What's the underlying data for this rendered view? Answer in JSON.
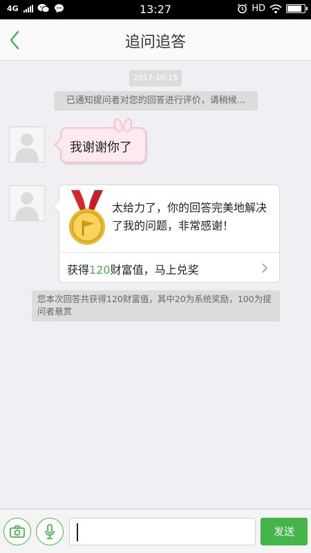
{
  "status_bar": {
    "network": "4G",
    "time": "13:27",
    "hd": "HD",
    "icons": [
      "wechat-icon",
      "chat-icon",
      "alarm-icon",
      "wifi-icon",
      "battery-icon"
    ]
  },
  "header": {
    "title": "追问追答",
    "back_icon": "chevron-left-icon"
  },
  "chat": {
    "date": "2017-10-15",
    "notice": "已通知提问者对您的回答进行评价，请稍候...",
    "message_1": {
      "text": "我谢谢你了"
    },
    "message_2": {
      "text": "太给力了，你的回答完美地解决了我的问题，非常感谢！",
      "footer_prefix": "获得",
      "footer_amount": "120",
      "footer_suffix": "财富值，马上兑奖"
    },
    "reward_notice": "您本次回答共获得120财富值，其中20为系统奖励，100为提问者悬赏"
  },
  "input_bar": {
    "send_label": "发送",
    "text_value": ""
  },
  "colors": {
    "accent": "#44b549",
    "pink_bubble": "#fde9ee",
    "pill": "#dcdcdc"
  }
}
